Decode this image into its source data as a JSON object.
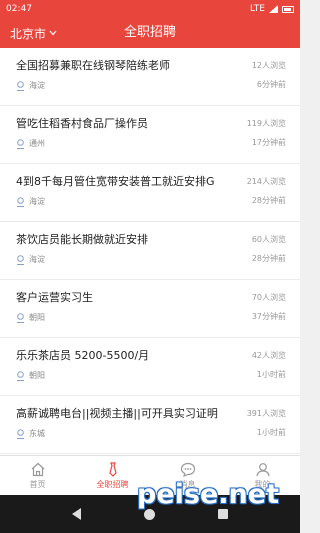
{
  "status_bar": {
    "time": "02:47",
    "network": "LTE"
  },
  "header": {
    "city": "北京市",
    "title": "全职招聘"
  },
  "jobs": [
    {
      "title": "全国招募兼职在线钢琴陪练老师",
      "location": "海淀",
      "views": "12人浏览",
      "time": "6分钟前"
    },
    {
      "title": "管吃住稻香村食品厂操作员",
      "location": "通州",
      "views": "119人浏览",
      "time": "17分钟前"
    },
    {
      "title": "4到8千每月管住宽带安装普工就近安排G",
      "location": "海淀",
      "views": "214人浏览",
      "time": "28分钟前"
    },
    {
      "title": "茶饮店员能长期做就近安排",
      "location": "海淀",
      "views": "60人浏览",
      "time": "28分钟前"
    },
    {
      "title": "客户运营实习生",
      "location": "朝阳",
      "views": "70人浏览",
      "time": "37分钟前"
    },
    {
      "title": "乐乐茶店员 5200-5500/月",
      "location": "朝阳",
      "views": "42人浏览",
      "time": "1小时前"
    },
    {
      "title": "高薪诚聘电台||视频主播||可开具实习证明",
      "location": "东城",
      "views": "391人浏览",
      "time": "1小时前"
    }
  ],
  "tabs": [
    {
      "label": "首页",
      "icon": "home-icon"
    },
    {
      "label": "全职招聘",
      "icon": "tie-icon"
    },
    {
      "label": "消息",
      "icon": "chat-icon"
    },
    {
      "label": "我的",
      "icon": "person-icon"
    }
  ],
  "colors": {
    "accent": "#e8453c",
    "navbar": "#1a1a1a"
  },
  "watermark": "peise.net"
}
